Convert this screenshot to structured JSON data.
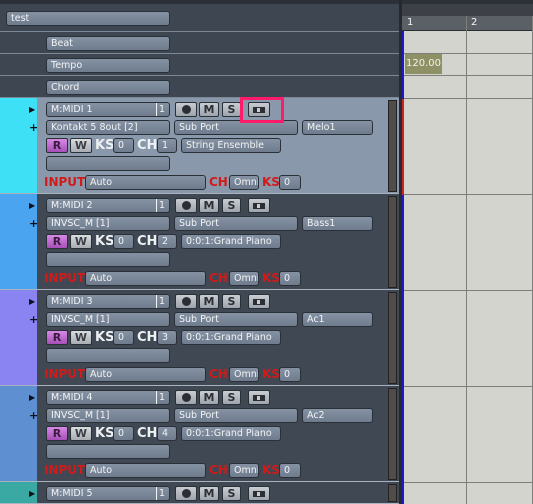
{
  "header_rows": [
    {
      "label": "test"
    },
    {
      "label": "Beat"
    },
    {
      "label": "Tempo"
    },
    {
      "label": "Chord"
    }
  ],
  "tracks": [
    {
      "name": "M:MIDI 1",
      "number": "1",
      "color": "#3de0f5",
      "port": "Kontakt 5 8out [2]",
      "sub_port": "Sub Port",
      "label": "Melo1",
      "ks": "0",
      "ch": "1",
      "program": "String Ensemble",
      "input": "Auto",
      "input_ch": "Omni",
      "input_ks": "0",
      "selected": true
    },
    {
      "name": "M:MIDI 2",
      "number": "1",
      "color": "#4aa4f0",
      "port": "INVSC_M [1]",
      "sub_port": "Sub Port",
      "label": "Bass1",
      "ks": "0",
      "ch": "2",
      "program": "0:0:1:Grand Piano",
      "input": "Auto",
      "input_ch": "Omni",
      "input_ks": "0",
      "selected": false
    },
    {
      "name": "M:MIDI 3",
      "number": "1",
      "color": "#8a84f2",
      "port": "INVSC_M [1]",
      "sub_port": "Sub Port",
      "label": "Ac1",
      "ks": "0",
      "ch": "3",
      "program": "0:0:1:Grand Piano",
      "input": "Auto",
      "input_ch": "Omni",
      "input_ks": "0",
      "selected": false
    },
    {
      "name": "M:MIDI 4",
      "number": "1",
      "color": "#5e8fd0",
      "port": "INVSC_M [1]",
      "sub_port": "Sub Port",
      "label": "Ac2",
      "ks": "0",
      "ch": "4",
      "program": "0:0:1:Grand Piano",
      "input": "Auto",
      "input_ch": "Omni",
      "input_ks": "0",
      "selected": false
    },
    {
      "name": "M:MIDI 5",
      "number": "1",
      "color": "#3aa9a4"
    }
  ],
  "labels": {
    "record": "R",
    "write": "W",
    "ks": "KS",
    "ch": "CH",
    "input": "INPUT",
    "mute": "M",
    "solo": "S"
  },
  "timeline": {
    "bars": [
      "1",
      "2"
    ],
    "tempo_value": "120.00"
  },
  "icons": {
    "expand": "play-triangle-icon",
    "add": "plus-icon",
    "record_arm": "record-dot-icon",
    "camera": "camera-icon"
  }
}
